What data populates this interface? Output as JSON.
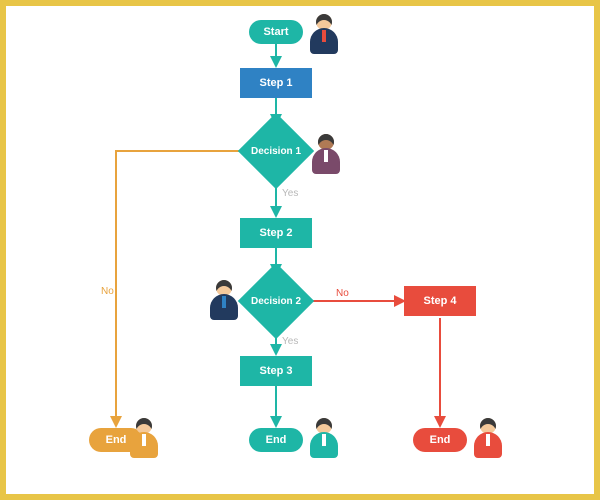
{
  "flow": {
    "start": "Start",
    "step1": "Step 1",
    "decision1": "Decision 1",
    "step2": "Step 2",
    "decision2": "Decision 2",
    "step3": "Step 3",
    "step4": "Step 4",
    "end1": "End",
    "end2": "End",
    "end3": "End"
  },
  "labels": {
    "yes1": "Yes",
    "no1": "No",
    "yes2": "Yes",
    "no2": "No"
  },
  "colors": {
    "teal": "#1eb6a6",
    "blue": "#2f82c4",
    "red": "#e84c3d",
    "orange": "#e8a33d"
  }
}
